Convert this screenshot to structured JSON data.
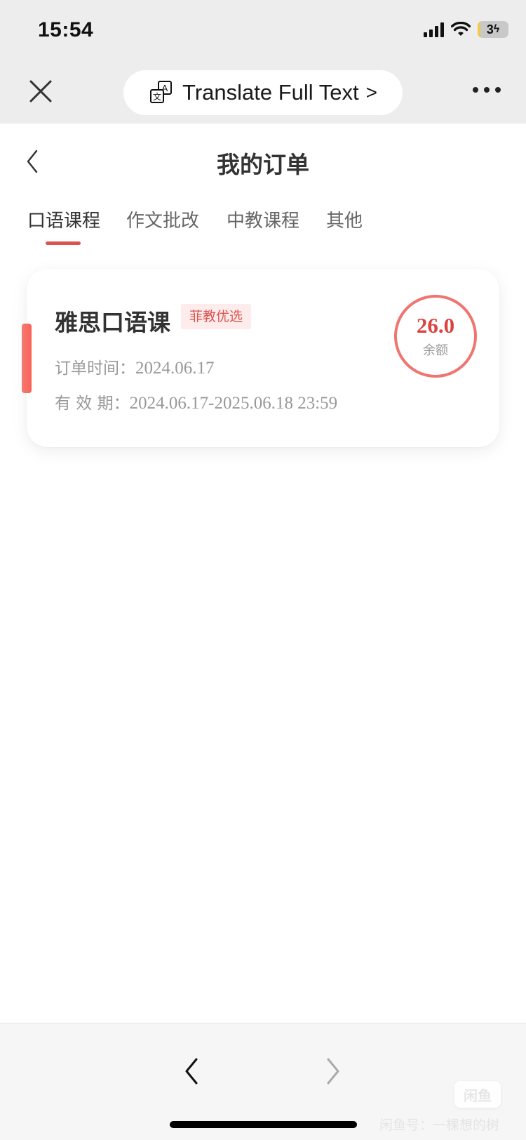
{
  "status_bar": {
    "time": "15:54",
    "battery_level": "3",
    "icons": [
      "cellular-signal-icon",
      "wifi-icon",
      "battery-charging-icon"
    ]
  },
  "browser_nav": {
    "close_icon": "close-icon",
    "translate_label": "Translate Full Text",
    "translate_chevron": ">",
    "translate_icon": "translate-icon",
    "more_icon": "more-dots-icon"
  },
  "page": {
    "title": "我的订单",
    "back_icon": "chevron-left-icon"
  },
  "tabs": [
    {
      "label": "口语课程",
      "active": true
    },
    {
      "label": "作文批改",
      "active": false
    },
    {
      "label": "中教课程",
      "active": false
    },
    {
      "label": "其他",
      "active": false
    }
  ],
  "orders": [
    {
      "course_name": "雅思口语课",
      "badge": "菲教优选",
      "order_time_label": "订单时间：",
      "order_time": "2024.06.17",
      "validity_label": "有 效 期：",
      "validity": "2024.06.17-2025.06.18 23:59",
      "balance": "26.0",
      "balance_label": "余额"
    }
  ],
  "bottom_nav": {
    "back_icon": "chevron-left-icon",
    "forward_icon": "chevron-right-icon"
  },
  "watermark": {
    "logo_text": "闲鱼",
    "text": "闲鱼号：一棵想的树"
  },
  "colors": {
    "accent": "#d9544f",
    "badge_bg": "#fdeceb",
    "header_bg": "#ededed",
    "bottom_bg": "#f6f6f6"
  }
}
